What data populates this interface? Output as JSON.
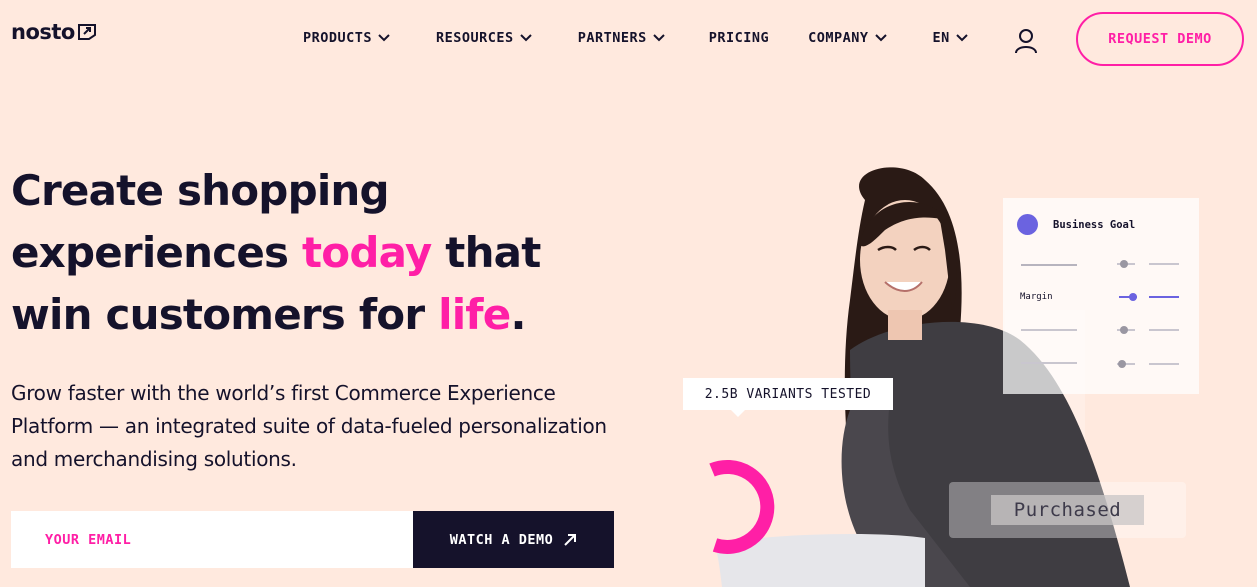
{
  "brand": {
    "logo_text": "nosto"
  },
  "nav": {
    "items": [
      {
        "label": "PRODUCTS",
        "has_dropdown": true
      },
      {
        "label": "RESOURCES",
        "has_dropdown": true
      },
      {
        "label": "PARTNERS",
        "has_dropdown": true
      },
      {
        "label": "PRICING",
        "has_dropdown": false
      },
      {
        "label": "COMPANY",
        "has_dropdown": true
      },
      {
        "label": "EN",
        "has_dropdown": true
      }
    ],
    "account_icon": "user-icon",
    "cta_label": "REQUEST DEMO"
  },
  "hero": {
    "headline_line1": "Create shopping",
    "headline_line2_a": "experiences ",
    "headline_line2_highlight": "today",
    "headline_line2_b": " that",
    "headline_line3_a": "win customers for ",
    "headline_line3_highlight": "life",
    "headline_line3_b": ".",
    "subtext": "Grow faster with the world’s first Commerce Experience Platform — an integrated suite of data-fueled personalization and merchandising solutions.",
    "email_placeholder": "YOUR EMAIL",
    "watch_demo_label": "WATCH A DEMO"
  },
  "illustration": {
    "goal_card_title": "Business Goal",
    "goal_card_label": "Margin",
    "variants_badge": "2.5B VARIANTS TESTED",
    "purchased_label": "Purchased"
  },
  "colors": {
    "accent": "#ff1fa6",
    "background": "#ffe9de",
    "dark": "#15122b",
    "indigo": "#6b63e0"
  }
}
